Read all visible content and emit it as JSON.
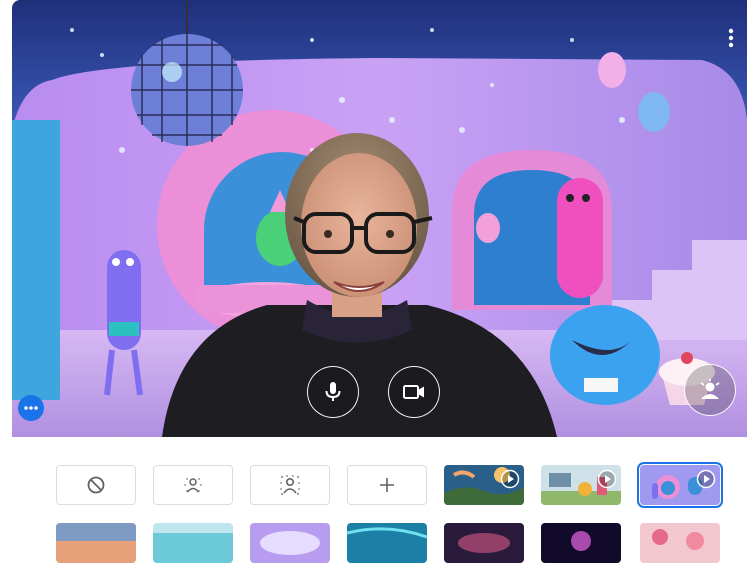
{
  "controls": {
    "more_options": "more-vert-icon",
    "microphone": "microphone-icon",
    "camera": "video-camera-icon",
    "effects": "person-effects-icon",
    "extra": "more-horiz-icon"
  },
  "background_options": {
    "row1": [
      {
        "kind": "none",
        "icon": "no-effect-icon"
      },
      {
        "kind": "blur-light",
        "icon": "slight-blur-icon"
      },
      {
        "kind": "blur-strong",
        "icon": "blur-icon"
      },
      {
        "kind": "upload",
        "icon": "plus-icon"
      },
      {
        "kind": "image",
        "animated": true,
        "scene": "magical forest"
      },
      {
        "kind": "image",
        "animated": true,
        "scene": "classroom"
      },
      {
        "kind": "image",
        "animated": true,
        "scene": "party",
        "selected": true
      }
    ],
    "row2": [
      {
        "kind": "image",
        "scene": "sunset"
      },
      {
        "kind": "image",
        "scene": "beach"
      },
      {
        "kind": "image",
        "scene": "clouds"
      },
      {
        "kind": "image",
        "scene": "underwater"
      },
      {
        "kind": "image",
        "scene": "galaxy"
      },
      {
        "kind": "image",
        "scene": "fireworks"
      },
      {
        "kind": "image",
        "scene": "flowers"
      }
    ]
  },
  "colors": {
    "accent": "#1a73e8",
    "tile_border": "#dadce0"
  }
}
